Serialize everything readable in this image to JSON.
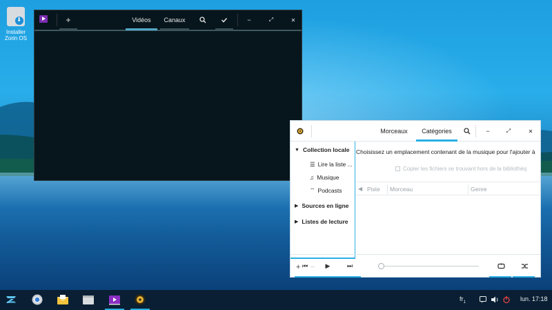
{
  "desktop": {
    "install_icon": {
      "label_line1": "Installer",
      "label_line2": "Zorin OS",
      "icon": "install-drive-icon"
    }
  },
  "video_window": {
    "add_icon": "+",
    "tabs": [
      {
        "label": "Vidéos"
      },
      {
        "label": "Canaux"
      }
    ],
    "search_icon": "search-icon",
    "check_icon": "check-icon",
    "minimize_icon": "−",
    "maximize_icon": "⤢",
    "close_icon": "✕"
  },
  "music_window": {
    "tabs": [
      {
        "label": "Morceaux"
      },
      {
        "label": "Catégories"
      }
    ],
    "minimize_icon": "−",
    "maximize_icon": "⤢",
    "close_icon": "✕",
    "sidebar": {
      "local_collection": "Collection locale",
      "play_queue": "Lire la liste ...",
      "music": "Musique",
      "podcasts": "Podcasts",
      "online_sources": "Sources en ligne",
      "playlists": "Listes de lecture",
      "add": "+",
      "remove": "−",
      "star": "☆"
    },
    "main": {
      "message": "Choisissez un emplacement contenant de la musique pour l'ajouter à",
      "copy_checkbox": "Copier les fichiers se trouvant hors de la bibliothèq",
      "columns": [
        "Piste",
        "Morceau",
        "Genre"
      ]
    },
    "player": {
      "prev": "⏮",
      "play": "▶",
      "next": "⏭",
      "repeat": "repeat-icon",
      "shuffle": "shuffle-icon",
      "progress": 0
    }
  },
  "taskbar": {
    "keyboard_layout": "fr",
    "keyboard_sub": "1",
    "clock": "lun. 17:18",
    "apps": [
      "zorin-menu-icon",
      "chromium-icon",
      "mail-icon",
      "files-icon",
      "video-player-icon",
      "music-player-icon"
    ]
  }
}
